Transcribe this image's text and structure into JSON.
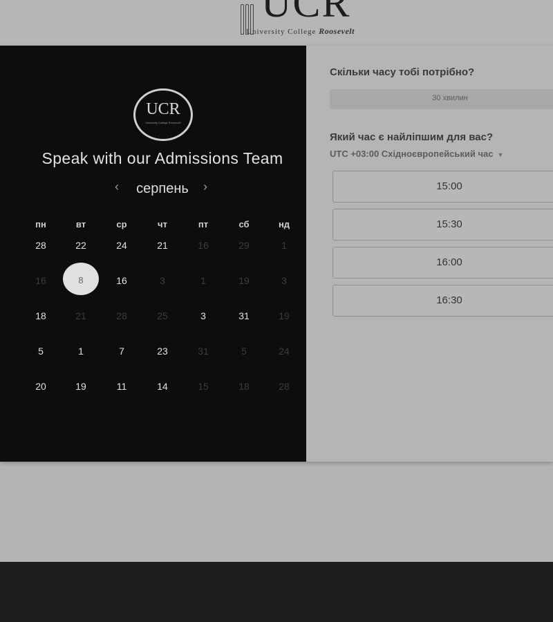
{
  "header": {
    "logo_letters": "UCR",
    "logo_subtitle": "University College",
    "logo_subtitle_bold": "Roosevelt"
  },
  "calendar": {
    "badge_text": "UCR",
    "badge_subtext": "University College Roosevelt",
    "title": "Speak with our Admissions Team",
    "month": "серпень",
    "prev_icon": "chevron-left-icon",
    "next_icon": "chevron-right-icon",
    "weekdays": [
      "пн",
      "вт",
      "ср",
      "чт",
      "пт",
      "сб",
      "нд"
    ],
    "weeks": [
      [
        "28",
        "22",
        "24",
        "21",
        "16",
        "29",
        "1"
      ],
      [
        "16",
        "8",
        "16",
        "3",
        "1",
        "19",
        "3"
      ],
      [
        "18",
        "21",
        "28",
        "25",
        "3",
        "31",
        "19"
      ],
      [
        "5",
        "1",
        "7",
        "23",
        "31",
        "5",
        "24"
      ],
      [
        "20",
        "19",
        "11",
        "14",
        "15",
        "18",
        "28"
      ]
    ],
    "dimmed": [
      [
        false,
        false,
        false,
        false,
        true,
        true,
        true
      ],
      [
        true,
        false,
        false,
        true,
        true,
        true,
        true
      ],
      [
        false,
        true,
        true,
        true,
        false,
        false,
        true
      ],
      [
        false,
        false,
        false,
        false,
        true,
        true,
        true
      ],
      [
        false,
        false,
        false,
        false,
        true,
        true,
        true
      ]
    ],
    "selected": {
      "week": 1,
      "day": 1
    }
  },
  "booking": {
    "duration_question": "Скільки часу тобі потрібно?",
    "duration_value": "30 хвилин",
    "time_question": "Який час є найліпшим для вас?",
    "timezone": "UTC +03:00 Східноєвропейський час",
    "slots": [
      "15:00",
      "15:30",
      "16:00",
      "16:30"
    ]
  }
}
